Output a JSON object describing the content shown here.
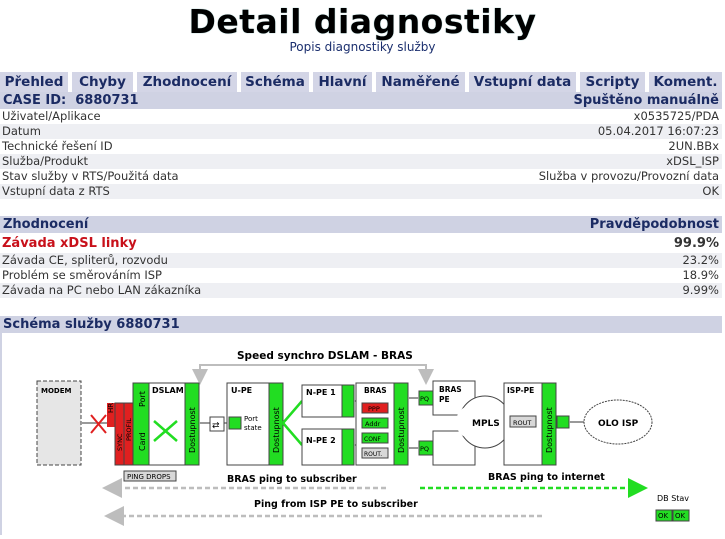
{
  "header": {
    "title": "Detail diagnostiky",
    "subtitle": "Popis diagnostiky služby"
  },
  "tabs": [
    "Přehled",
    "Chyby",
    "Zhodnocení",
    "Schéma",
    "Hlavní",
    "Naměřené",
    "Vstupní data",
    "Scripty",
    "Koment."
  ],
  "case": {
    "label": "CASE ID:",
    "id": "6880731",
    "status": "Spuštěno manuálně",
    "rows": [
      {
        "label": "Uživatel/Aplikace",
        "value": "x0535725/PDA"
      },
      {
        "label": "Datum",
        "value": "05.04.2017 16:07:23"
      },
      {
        "label": "Technické řešení ID",
        "value": "2UN.BBx"
      },
      {
        "label": "Služba/Produkt",
        "value": "xDSL_ISP"
      },
      {
        "label": "Stav služby v RTS/Použitá data",
        "value": "Služba v provozu/Provozní data"
      },
      {
        "label": "Vstupní data z RTS",
        "value": "OK"
      }
    ]
  },
  "evaluation": {
    "title": "Zhodnocení",
    "prob_label": "Pravděpodobnost",
    "items": [
      {
        "label": "Závada xDSL linky",
        "value": "99.9%"
      },
      {
        "label": "Závada CE, spliterů, rozvodu",
        "value": "23.2%"
      },
      {
        "label": "Problém se směrováním ISP",
        "value": "18.9%"
      },
      {
        "label": "Závada na PC nebo LAN zákazníka",
        "value": "9.99%"
      }
    ]
  },
  "schema": {
    "title": "Schéma služby 6880731",
    "labels": {
      "speed": "Speed synchro DSLAM - BRAS",
      "modem": "MODEM",
      "hr": "HR",
      "sync": "SYNC",
      "profil": "PROFIL",
      "card": "Card",
      "port": "Port",
      "dslam": "DSLAM",
      "dostupnost": "Dostupnost",
      "upe": "U-PE",
      "port_state_1": "Port",
      "port_state_2": "state",
      "npe1": "N-PE 1",
      "npe2": "N-PE 2",
      "bras": "BRAS",
      "ppp": "PPP",
      "addr": "Addr",
      "conf": "CONF",
      "rout": "ROUT.",
      "pq": "PQ",
      "bras_pe_1": "BRAS",
      "bras_pe_2": "PE",
      "mpls": "MPLS",
      "isp_pe": "ISP-PE",
      "rout2": "ROUT",
      "olo": "OLO ISP",
      "ping_drops": "PING DROPS",
      "bras_ping_sub": "BRAS ping to subscriber",
      "bras_ping_int": "BRAS ping to internet",
      "ping_isp": "Ping from ISP PE to subscriber",
      "db_stav": "DB Stav",
      "ok": "OK"
    }
  },
  "colors": {
    "green": "#22dd22",
    "red": "#e02020",
    "header_bg": "#cfd2e3",
    "accent": "#1b2b63"
  }
}
